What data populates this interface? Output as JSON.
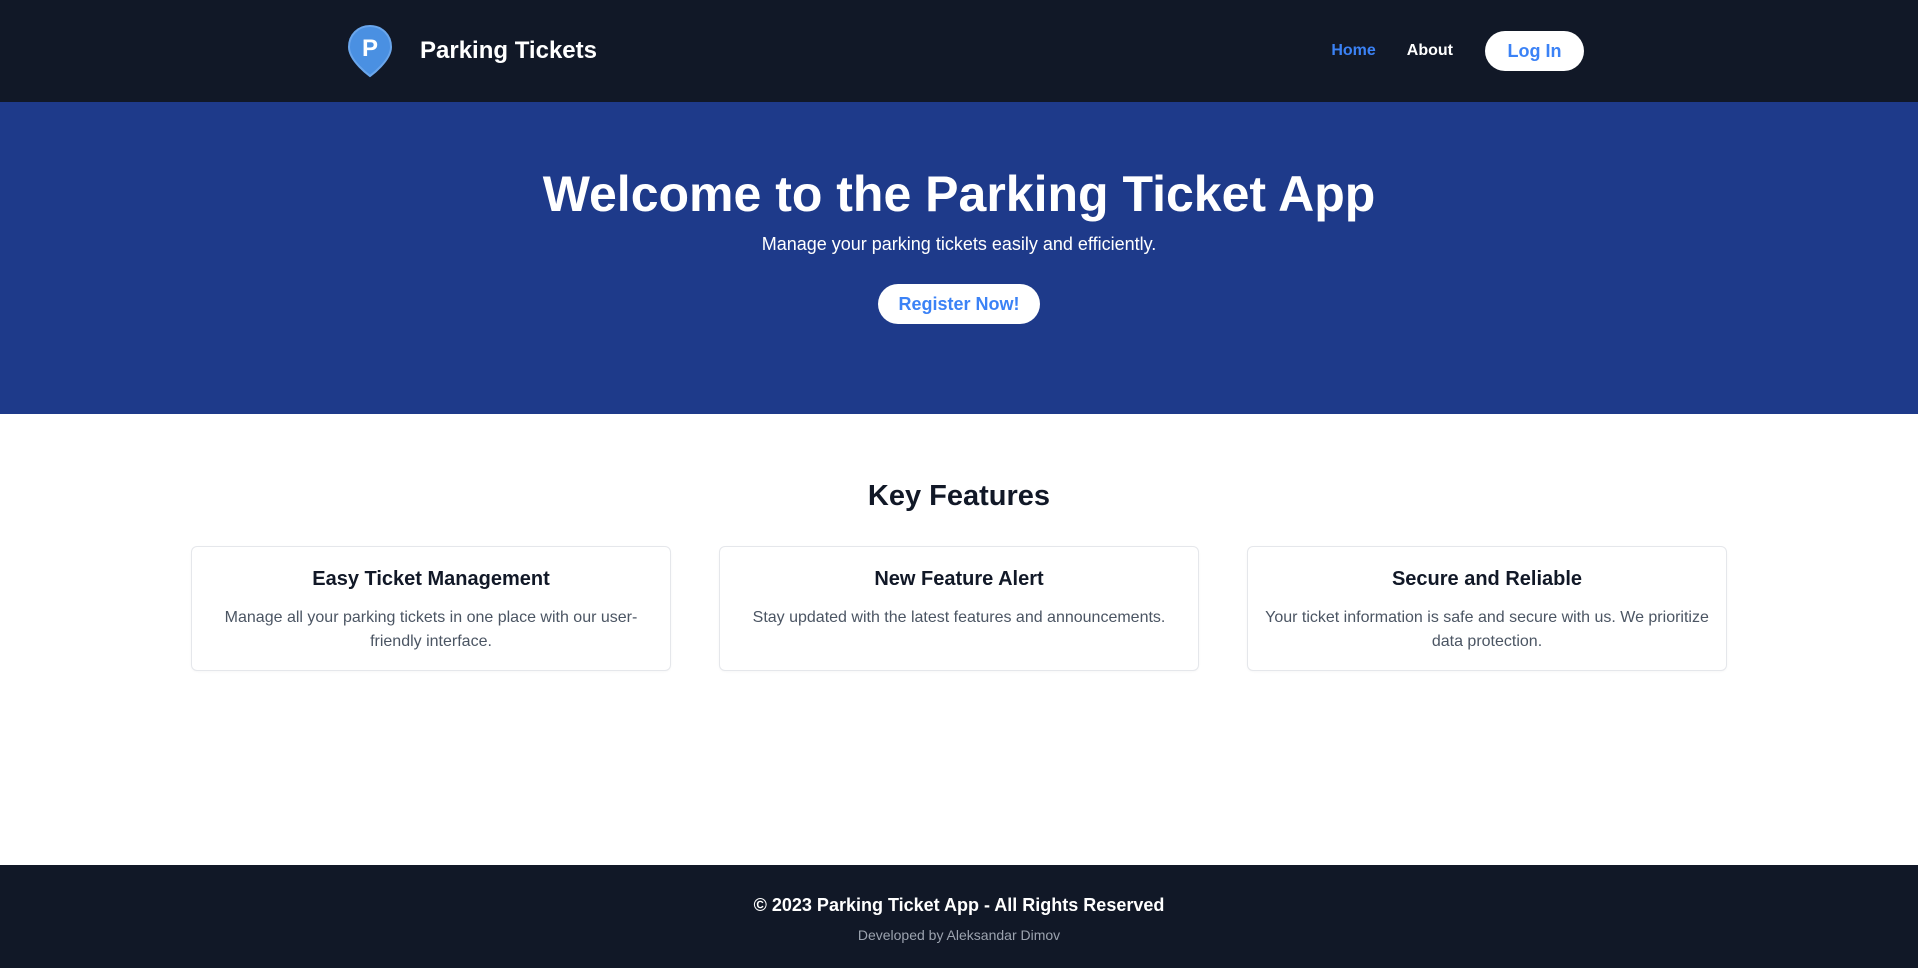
{
  "colors": {
    "nav_bg": "#111827",
    "hero_bg": "#1e3a8a",
    "accent": "#3b82f6",
    "logo_pin": "#4a90e2"
  },
  "navbar": {
    "logo_icon": "parking-pin-icon",
    "logo_letter": "P",
    "brand": "Parking Tickets",
    "links": [
      "Home",
      "About"
    ],
    "login_label": "Log In"
  },
  "hero": {
    "title": "Welcome to the Parking Ticket App",
    "subtitle": "Manage your parking tickets easily and efficiently.",
    "cta_label": "Register Now!"
  },
  "features": {
    "title": "Key Features",
    "cards": [
      {
        "title": "Easy Ticket Management",
        "text": "Manage all your parking tickets in one place with our user-friendly interface."
      },
      {
        "title": "New Feature Alert",
        "text": "Stay updated with the latest features and announcements."
      },
      {
        "title": "Secure and Reliable",
        "text": "Your ticket information is safe and secure with us. We prioritize data protection."
      }
    ]
  },
  "footer": {
    "copyright": "© 2023 Parking Ticket App - All Rights Reserved",
    "developer": "Developed by Aleksandar Dimov"
  }
}
